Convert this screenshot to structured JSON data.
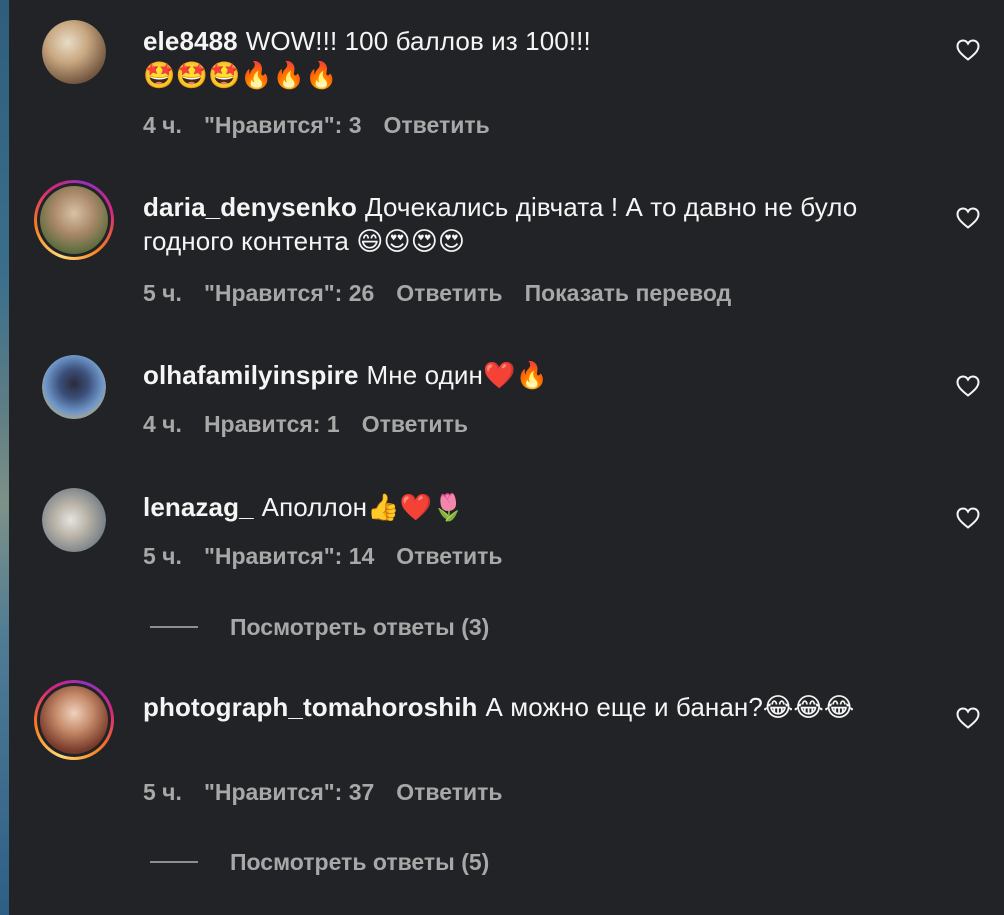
{
  "comments": [
    {
      "username": "ele8488",
      "text": "WOW!!! 100 баллов из 100!!!",
      "emoji_line": "🤩🤩🤩🔥🔥🔥",
      "time": "4 ч.",
      "likes": "\"Нравится\": 3",
      "reply": "Ответить",
      "avatar_color": "#c9b79f"
    },
    {
      "username": "daria_denysenko",
      "text": "Дочекались дівчата ! А то давно не було годного контента 😄😍😍😍",
      "time": "5 ч.",
      "likes": "\"Нравится\": 26",
      "reply": "Ответить",
      "translate": "Показать перевод",
      "avatar_color": "#a08a6d"
    },
    {
      "username": "olhafamilyinspire",
      "text": "Мне один❤️🔥",
      "time": "4 ч.",
      "likes": "Нравится: 1",
      "reply": "Ответить",
      "avatar_color": "#4d7fb8"
    },
    {
      "username": "lenazag_",
      "text": "Аполлон👍❤️🌷",
      "time": "5 ч.",
      "likes": "\"Нравится\": 14",
      "reply": "Ответить",
      "view_replies": "Посмотреть ответы (3)",
      "avatar_color": "#9aa3a6"
    },
    {
      "username": "photograph_tomahoroshih",
      "text": "А можно еще и банан?😂😂😂",
      "time": "5 ч.",
      "likes": "\"Нравится\": 37",
      "reply": "Ответить",
      "view_replies": "Посмотреть ответы (5)",
      "avatar_color": "#a06a52"
    }
  ],
  "colors": {
    "background": "#222326",
    "text": "#f5f5f5",
    "secondary": "#a8a8a8"
  }
}
